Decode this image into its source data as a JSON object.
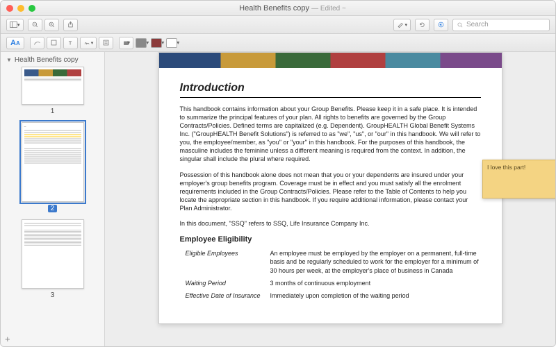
{
  "window": {
    "title": "Health Benefits copy",
    "edited": "— Edited ~"
  },
  "search": {
    "placeholder": "Search"
  },
  "sidebar": {
    "title": "Health Benefits copy",
    "thumbs": [
      {
        "num": "1"
      },
      {
        "num": "2"
      },
      {
        "num": "3"
      }
    ]
  },
  "doc": {
    "heading": "Introduction",
    "para1": "This handbook contains information about your Group Benefits.  Please keep it in a safe place.  It is intended to summarize the principal features of your plan.  All rights to benefits are governed by the Group Contracts/Policies.  Defined terms are capitalized (e.g. Dependent).  GroupHEALTH Global Benefit Systems Inc. (\"GroupHEALTH Benefit Solutions\") is referred to as \"we\", \"us\", or \"our\" in this handbook.  We will refer to you, the employee/member, as \"you\" or \"your\" in this handbook.  For the purposes of this handbook, the masculine includes the feminine unless a different meaning is required from the context.  In addition, the singular shall include the plural where required.",
    "para2": "Possession of this handbook alone does not mean that you or your dependents are insured under your employer's group benefits program.  Coverage must be in effect and you must satisfy all the enrolment requirements included in the Group Contracts/Policies.  Please refer to the Table of Contents to help you locate the appropriate section in this handbook.  If you require additional information, please contact your Plan Administrator.",
    "para3": "In this document, \"SSQ\" refers to SSQ, Life Insurance Company Inc.",
    "subheading": "Employee Eligibility",
    "rows": [
      {
        "label": "Eligible Employees",
        "value": "An employee must be employed by the employer on a permanent, full-time basis and be regularly scheduled to work for the employer for a minimum of 30 hours per week, at the employer's place of business in Canada"
      },
      {
        "label": "Waiting Period",
        "value": "3 months of continuous employment"
      },
      {
        "label": "Effective Date of Insurance",
        "value": "Immediately upon completion of the waiting period"
      }
    ]
  },
  "note": {
    "text": "I love this part!"
  }
}
